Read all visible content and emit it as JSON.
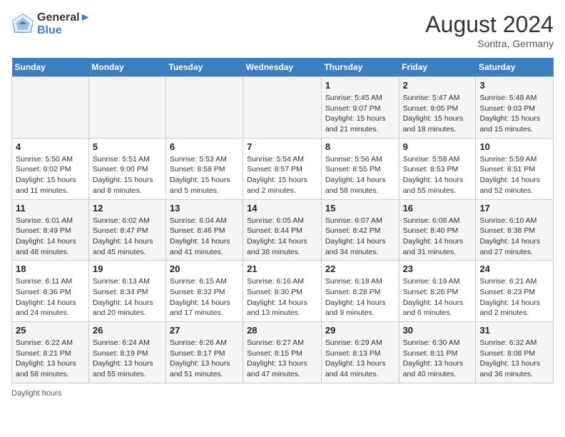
{
  "header": {
    "logo_line1": "General",
    "logo_line2": "Blue",
    "month_year": "August 2024",
    "location": "Sontra, Germany"
  },
  "days_of_week": [
    "Sunday",
    "Monday",
    "Tuesday",
    "Wednesday",
    "Thursday",
    "Friday",
    "Saturday"
  ],
  "weeks": [
    [
      {
        "day": "",
        "sunrise": "",
        "sunset": "",
        "daylight": ""
      },
      {
        "day": "",
        "sunrise": "",
        "sunset": "",
        "daylight": ""
      },
      {
        "day": "",
        "sunrise": "",
        "sunset": "",
        "daylight": ""
      },
      {
        "day": "",
        "sunrise": "",
        "sunset": "",
        "daylight": ""
      },
      {
        "day": "1",
        "sunrise": "Sunrise: 5:45 AM",
        "sunset": "Sunset: 9:07 PM",
        "daylight": "Daylight: 15 hours and 21 minutes."
      },
      {
        "day": "2",
        "sunrise": "Sunrise: 5:47 AM",
        "sunset": "Sunset: 9:05 PM",
        "daylight": "Daylight: 15 hours and 18 minutes."
      },
      {
        "day": "3",
        "sunrise": "Sunrise: 5:48 AM",
        "sunset": "Sunset: 9:03 PM",
        "daylight": "Daylight: 15 hours and 15 minutes."
      }
    ],
    [
      {
        "day": "4",
        "sunrise": "Sunrise: 5:50 AM",
        "sunset": "Sunset: 9:02 PM",
        "daylight": "Daylight: 15 hours and 11 minutes."
      },
      {
        "day": "5",
        "sunrise": "Sunrise: 5:51 AM",
        "sunset": "Sunset: 9:00 PM",
        "daylight": "Daylight: 15 hours and 8 minutes."
      },
      {
        "day": "6",
        "sunrise": "Sunrise: 5:53 AM",
        "sunset": "Sunset: 8:58 PM",
        "daylight": "Daylight: 15 hours and 5 minutes."
      },
      {
        "day": "7",
        "sunrise": "Sunrise: 5:54 AM",
        "sunset": "Sunset: 8:57 PM",
        "daylight": "Daylight: 15 hours and 2 minutes."
      },
      {
        "day": "8",
        "sunrise": "Sunrise: 5:56 AM",
        "sunset": "Sunset: 8:55 PM",
        "daylight": "Daylight: 14 hours and 58 minutes."
      },
      {
        "day": "9",
        "sunrise": "Sunrise: 5:58 AM",
        "sunset": "Sunset: 8:53 PM",
        "daylight": "Daylight: 14 hours and 55 minutes."
      },
      {
        "day": "10",
        "sunrise": "Sunrise: 5:59 AM",
        "sunset": "Sunset: 8:51 PM",
        "daylight": "Daylight: 14 hours and 52 minutes."
      }
    ],
    [
      {
        "day": "11",
        "sunrise": "Sunrise: 6:01 AM",
        "sunset": "Sunset: 8:49 PM",
        "daylight": "Daylight: 14 hours and 48 minutes."
      },
      {
        "day": "12",
        "sunrise": "Sunrise: 6:02 AM",
        "sunset": "Sunset: 8:47 PM",
        "daylight": "Daylight: 14 hours and 45 minutes."
      },
      {
        "day": "13",
        "sunrise": "Sunrise: 6:04 AM",
        "sunset": "Sunset: 8:46 PM",
        "daylight": "Daylight: 14 hours and 41 minutes."
      },
      {
        "day": "14",
        "sunrise": "Sunrise: 6:05 AM",
        "sunset": "Sunset: 8:44 PM",
        "daylight": "Daylight: 14 hours and 38 minutes."
      },
      {
        "day": "15",
        "sunrise": "Sunrise: 6:07 AM",
        "sunset": "Sunset: 8:42 PM",
        "daylight": "Daylight: 14 hours and 34 minutes."
      },
      {
        "day": "16",
        "sunrise": "Sunrise: 6:08 AM",
        "sunset": "Sunset: 8:40 PM",
        "daylight": "Daylight: 14 hours and 31 minutes."
      },
      {
        "day": "17",
        "sunrise": "Sunrise: 6:10 AM",
        "sunset": "Sunset: 8:38 PM",
        "daylight": "Daylight: 14 hours and 27 minutes."
      }
    ],
    [
      {
        "day": "18",
        "sunrise": "Sunrise: 6:11 AM",
        "sunset": "Sunset: 8:36 PM",
        "daylight": "Daylight: 14 hours and 24 minutes."
      },
      {
        "day": "19",
        "sunrise": "Sunrise: 6:13 AM",
        "sunset": "Sunset: 8:34 PM",
        "daylight": "Daylight: 14 hours and 20 minutes."
      },
      {
        "day": "20",
        "sunrise": "Sunrise: 6:15 AM",
        "sunset": "Sunset: 8:32 PM",
        "daylight": "Daylight: 14 hours and 17 minutes."
      },
      {
        "day": "21",
        "sunrise": "Sunrise: 6:16 AM",
        "sunset": "Sunset: 8:30 PM",
        "daylight": "Daylight: 14 hours and 13 minutes."
      },
      {
        "day": "22",
        "sunrise": "Sunrise: 6:18 AM",
        "sunset": "Sunset: 8:28 PM",
        "daylight": "Daylight: 14 hours and 9 minutes."
      },
      {
        "day": "23",
        "sunrise": "Sunrise: 6:19 AM",
        "sunset": "Sunset: 8:26 PM",
        "daylight": "Daylight: 14 hours and 6 minutes."
      },
      {
        "day": "24",
        "sunrise": "Sunrise: 6:21 AM",
        "sunset": "Sunset: 8:23 PM",
        "daylight": "Daylight: 14 hours and 2 minutes."
      }
    ],
    [
      {
        "day": "25",
        "sunrise": "Sunrise: 6:22 AM",
        "sunset": "Sunset: 8:21 PM",
        "daylight": "Daylight: 13 hours and 58 minutes."
      },
      {
        "day": "26",
        "sunrise": "Sunrise: 6:24 AM",
        "sunset": "Sunset: 8:19 PM",
        "daylight": "Daylight: 13 hours and 55 minutes."
      },
      {
        "day": "27",
        "sunrise": "Sunrise: 6:26 AM",
        "sunset": "Sunset: 8:17 PM",
        "daylight": "Daylight: 13 hours and 51 minutes."
      },
      {
        "day": "28",
        "sunrise": "Sunrise: 6:27 AM",
        "sunset": "Sunset: 8:15 PM",
        "daylight": "Daylight: 13 hours and 47 minutes."
      },
      {
        "day": "29",
        "sunrise": "Sunrise: 6:29 AM",
        "sunset": "Sunset: 8:13 PM",
        "daylight": "Daylight: 13 hours and 44 minutes."
      },
      {
        "day": "30",
        "sunrise": "Sunrise: 6:30 AM",
        "sunset": "Sunset: 8:11 PM",
        "daylight": "Daylight: 13 hours and 40 minutes."
      },
      {
        "day": "31",
        "sunrise": "Sunrise: 6:32 AM",
        "sunset": "Sunset: 8:08 PM",
        "daylight": "Daylight: 13 hours and 36 minutes."
      }
    ]
  ],
  "footer": {
    "text": "Daylight hours"
  }
}
